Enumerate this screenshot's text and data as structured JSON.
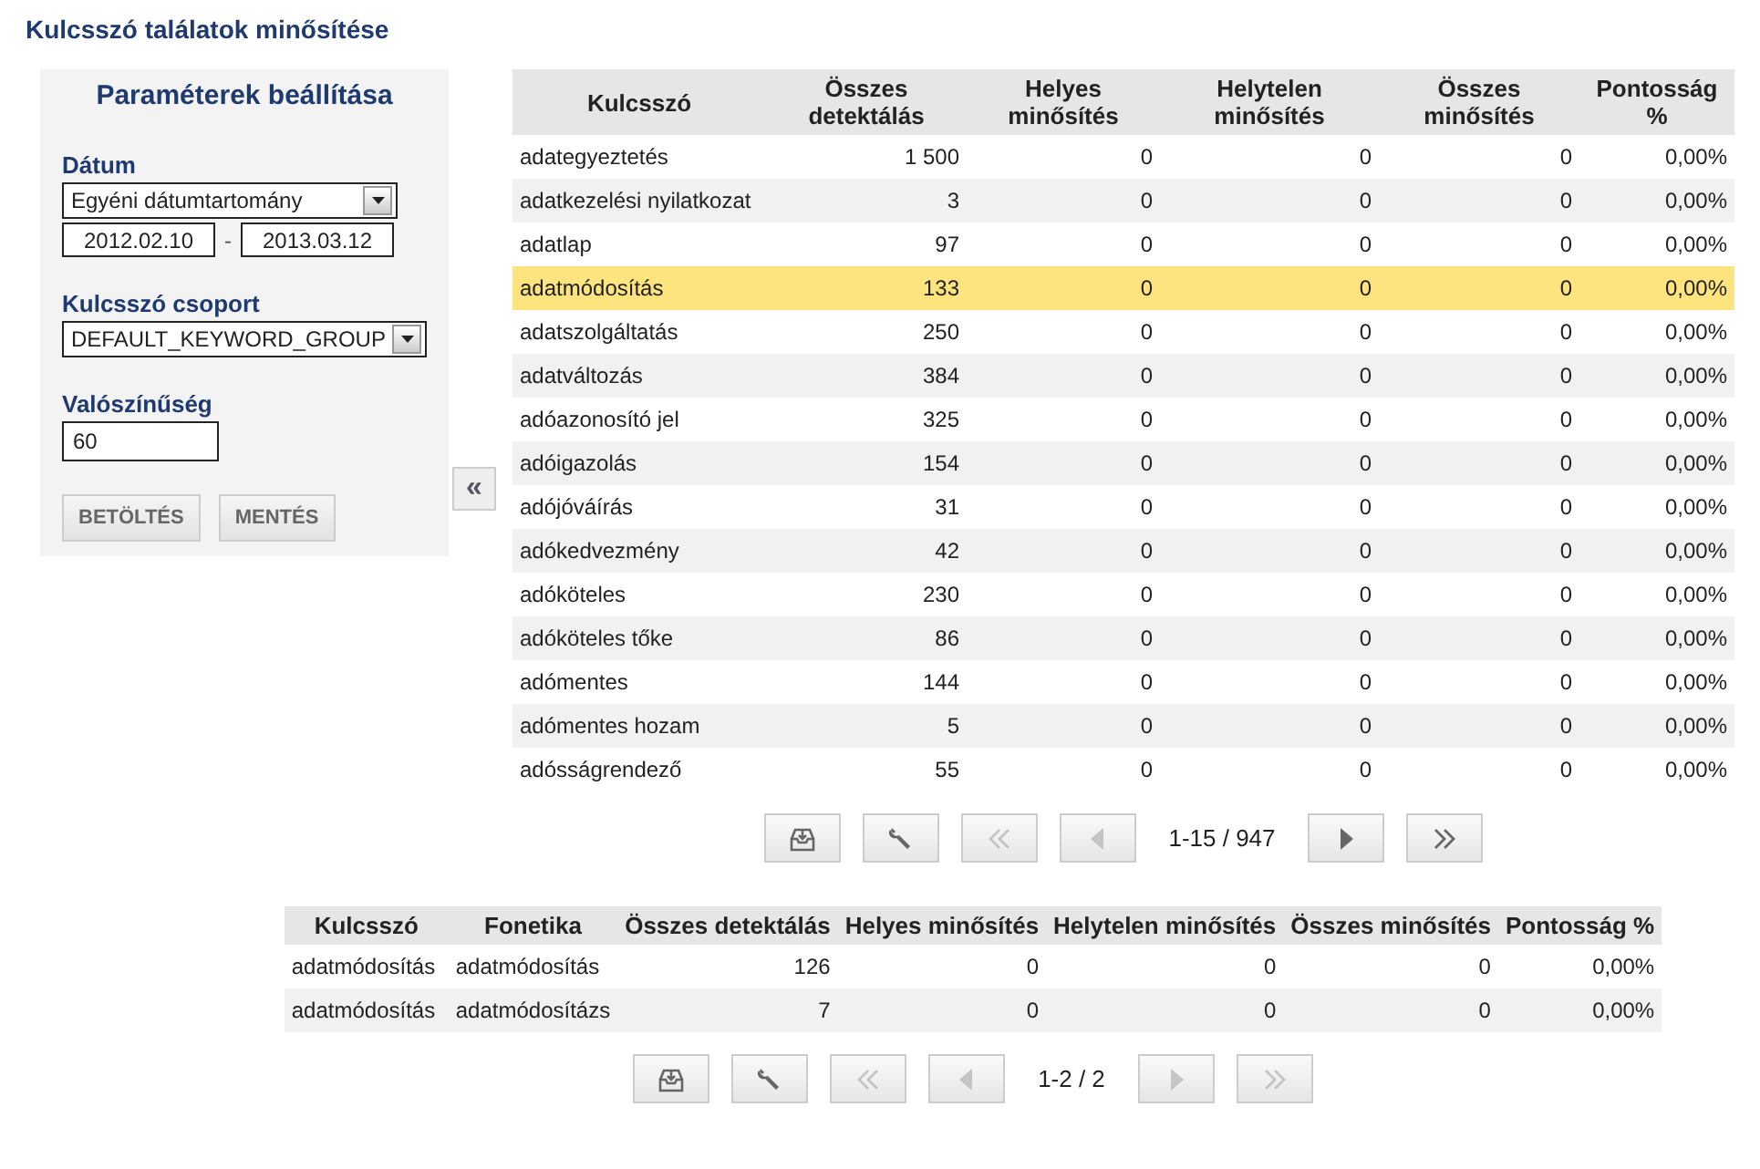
{
  "title": "Kulcsszó találatok minősítése",
  "panel": {
    "title": "Paraméterek beállítása",
    "fields": [
      {
        "kind": "date",
        "label": "Dátum",
        "value": "Egyéni dátumtartomány",
        "from": "2012.02.10",
        "separator": "-",
        "to": "2013.03.12"
      },
      {
        "kind": "select",
        "label": "Kulcsszó csoport",
        "value": "DEFAULT_KEYWORD_GROUP"
      },
      {
        "kind": "text",
        "label": "Valószínűség",
        "value": "60"
      }
    ],
    "buttons": [
      "BETÖLTÉS",
      "MENTÉS"
    ]
  },
  "collapse": {
    "icon": "«"
  },
  "table": {
    "columns": [
      "Kulcsszó",
      "Összes detektálás",
      "Helyes minősítés",
      "Helytelen minősítés",
      "Összes minősítés",
      "Pontosság %"
    ],
    "rows": [
      {
        "cells": [
          "adategyeztetés",
          "1 500",
          "0",
          "0",
          "0",
          "0,00%"
        ],
        "selected": false
      },
      {
        "cells": [
          "adatkezelési nyilatkozat",
          "3",
          "0",
          "0",
          "0",
          "0,00%"
        ],
        "selected": false
      },
      {
        "cells": [
          "adatlap",
          "97",
          "0",
          "0",
          "0",
          "0,00%"
        ],
        "selected": false
      },
      {
        "cells": [
          "adatmódosítás",
          "133",
          "0",
          "0",
          "0",
          "0,00%"
        ],
        "selected": true
      },
      {
        "cells": [
          "adatszolgáltatás",
          "250",
          "0",
          "0",
          "0",
          "0,00%"
        ],
        "selected": false
      },
      {
        "cells": [
          "adatváltozás",
          "384",
          "0",
          "0",
          "0",
          "0,00%"
        ],
        "selected": false
      },
      {
        "cells": [
          "adóazonosító jel",
          "325",
          "0",
          "0",
          "0",
          "0,00%"
        ],
        "selected": false
      },
      {
        "cells": [
          "adóigazolás",
          "154",
          "0",
          "0",
          "0",
          "0,00%"
        ],
        "selected": false
      },
      {
        "cells": [
          "adójóváírás",
          "31",
          "0",
          "0",
          "0",
          "0,00%"
        ],
        "selected": false
      },
      {
        "cells": [
          "adókedvezmény",
          "42",
          "0",
          "0",
          "0",
          "0,00%"
        ],
        "selected": false
      },
      {
        "cells": [
          "adóköteles",
          "230",
          "0",
          "0",
          "0",
          "0,00%"
        ],
        "selected": false
      },
      {
        "cells": [
          "adóköteles tőke",
          "86",
          "0",
          "0",
          "0",
          "0,00%"
        ],
        "selected": false
      },
      {
        "cells": [
          "adómentes",
          "144",
          "0",
          "0",
          "0",
          "0,00%"
        ],
        "selected": false
      },
      {
        "cells": [
          "adómentes hozam",
          "5",
          "0",
          "0",
          "0",
          "0,00%"
        ],
        "selected": false
      },
      {
        "cells": [
          "adósságrendező",
          "55",
          "0",
          "0",
          "0",
          "0,00%"
        ],
        "selected": false
      }
    ],
    "pager": {
      "info": "1-15 / 947",
      "buttons": [
        {
          "kind": "export",
          "disabled": false
        },
        {
          "kind": "settings",
          "disabled": false
        },
        {
          "kind": "first",
          "disabled": true
        },
        {
          "kind": "prev",
          "disabled": true
        },
        {
          "kind": "next",
          "disabled": false
        },
        {
          "kind": "last",
          "disabled": false
        }
      ]
    }
  },
  "detail_table": {
    "columns": [
      "Kulcsszó",
      "Fonetika",
      "Összes detektálás",
      "Helyes minősítés",
      "Helytelen minősítés",
      "Összes minősítés",
      "Pontosság %"
    ],
    "rows": [
      {
        "cells": [
          "adatmódosítás",
          "adatmódosítás",
          "126",
          "0",
          "0",
          "0",
          "0,00%"
        ],
        "selected": false
      },
      {
        "cells": [
          "adatmódosítás",
          "adatmódosítázs",
          "7",
          "0",
          "0",
          "0",
          "0,00%"
        ],
        "selected": false
      }
    ],
    "pager": {
      "info": "1-2 / 2",
      "buttons": [
        {
          "kind": "export",
          "disabled": false
        },
        {
          "kind": "settings",
          "disabled": false
        },
        {
          "kind": "first",
          "disabled": true
        },
        {
          "kind": "prev",
          "disabled": true
        },
        {
          "kind": "next",
          "disabled": true
        },
        {
          "kind": "last",
          "disabled": true
        }
      ]
    }
  }
}
